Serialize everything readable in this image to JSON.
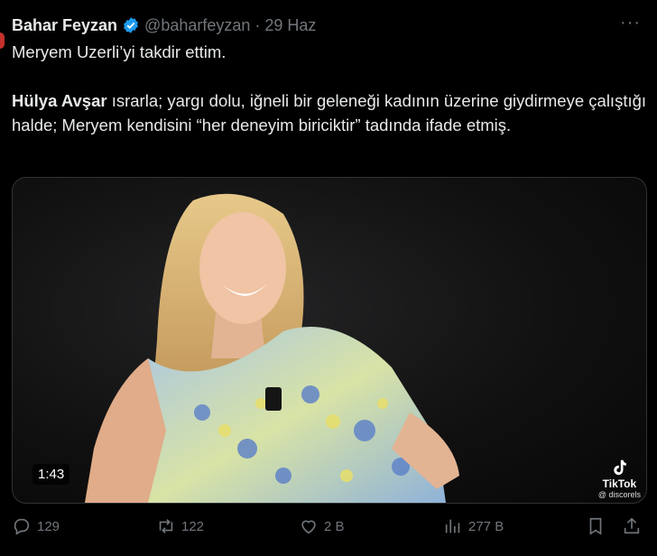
{
  "tweet": {
    "author_name": "Bahar Feyzan",
    "handle": "@baharfeyzan",
    "separator": "·",
    "date": "29 Haz",
    "more": "···",
    "line1": "Meryem Uzerli’yi takdir ettim.",
    "mention": "Hülya Avşar",
    "body": " ısrarla; yargı dolu, iğneli bir geleneği kadının üzerine giydirmeye çalıştığı halde; Meryem kendisini “her deneyim biriciktir” tadında ifade etmiş."
  },
  "media": {
    "duration": "1:43",
    "watermark_brand": "TikTok",
    "watermark_user": "@ discorels"
  },
  "actions": {
    "replies": "129",
    "reposts": "122",
    "likes": "2 B",
    "views": "277 B"
  },
  "colors": {
    "background": "#000000",
    "text": "#e7e9ea",
    "muted": "#71767b",
    "verified": "#1d9bf0"
  },
  "icons": [
    "verified-icon",
    "more-icon",
    "reply-icon",
    "repost-icon",
    "like-icon",
    "views-icon",
    "bookmark-icon",
    "share-icon",
    "tiktok-icon"
  ]
}
